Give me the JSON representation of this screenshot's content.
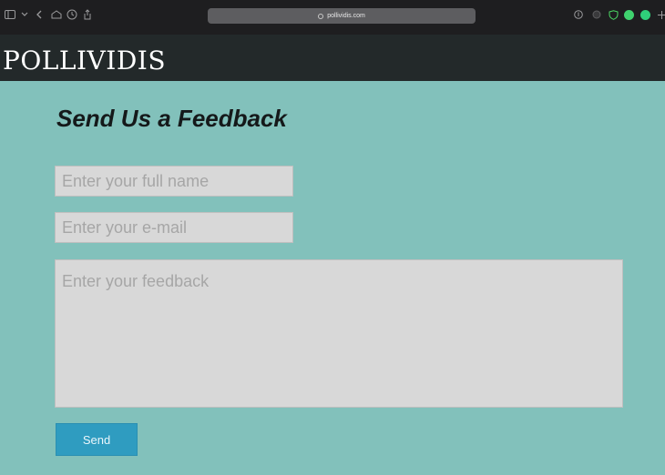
{
  "browser": {
    "url": "pollividis.com",
    "icons": [
      "sidebar-icon",
      "chevron-down-icon",
      "back-icon",
      "home-icon",
      "history-icon",
      "share-icon",
      "download-icon",
      "shield-icon",
      "heart-shield-icon",
      "camera-icon",
      "extension-icon",
      "plus-icon"
    ]
  },
  "site": {
    "brand": "POLLIVIDIS"
  },
  "form": {
    "title": "Send Us a Feedback",
    "name_placeholder": "Enter your full name",
    "email_placeholder": "Enter your e-mail",
    "feedback_placeholder": "Enter your feedback",
    "send_label": "Send"
  },
  "colors": {
    "page_background": "#82c1bb",
    "header_background": "#23292a",
    "button": "#2f9cc0",
    "field_background": "#d8d8d8"
  }
}
